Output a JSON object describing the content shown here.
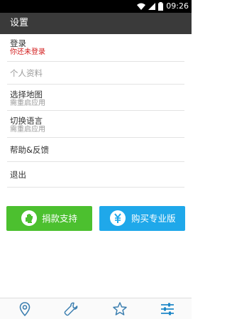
{
  "status_bar": {
    "time": "09:26",
    "icons": [
      "wifi-icon",
      "signal-icon",
      "battery-icon"
    ]
  },
  "app_bar": {
    "title": "设置"
  },
  "settings": {
    "login": {
      "label": "登录",
      "status": "你还未登录"
    },
    "profile": {
      "label": "个人资料"
    },
    "map": {
      "label": "选择地图",
      "note": "需重启应用"
    },
    "language": {
      "label": "切换语言",
      "note": "需重启应用"
    },
    "help": {
      "label": "帮助&反馈"
    },
    "exit": {
      "label": "退出"
    }
  },
  "buttons": {
    "donate": {
      "label": "捐款支持",
      "icon": "hand-icon",
      "color": "#4cc02f"
    },
    "pro": {
      "label": "购买专业版",
      "icon": "yen-coin-icon",
      "color": "#1fa8ea"
    }
  },
  "bottom_nav": {
    "tabs": [
      {
        "icon": "map-pin-icon"
      },
      {
        "icon": "wrench-icon"
      },
      {
        "icon": "star-icon"
      },
      {
        "icon": "sliders-icon",
        "active": true
      }
    ],
    "active_color": "#1e88c8",
    "inactive_color": "#3c7fb0"
  },
  "colors": {
    "app_bar": "#3a3a3a",
    "login_status": "#d21a1a"
  }
}
